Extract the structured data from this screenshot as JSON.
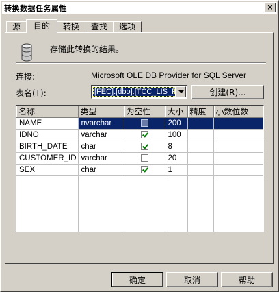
{
  "window": {
    "title": "转换数据任务属性",
    "close_label": "×"
  },
  "tabs": [
    {
      "label": "源",
      "active": false
    },
    {
      "label": "目的",
      "active": true
    },
    {
      "label": "转换",
      "active": false
    },
    {
      "label": "查找",
      "active": false
    },
    {
      "label": "选项",
      "active": false
    }
  ],
  "destination": {
    "icon": "database-icon",
    "description": "存储此转换的结果。",
    "connection_label": "连接:",
    "connection_value": "Microsoft OLE DB Provider for SQL Server",
    "table_label": "表名(T):",
    "table_value": "[FEC].[dbo].[TCC_LIS_PE",
    "create_button": "创建(R)..."
  },
  "grid": {
    "headers": [
      "名称",
      "类型",
      "为空性",
      "大小",
      "精度",
      "小数位数"
    ],
    "rows": [
      {
        "name": "NAME",
        "type": "nvarchar",
        "nullable": false,
        "size": "200",
        "precision": "",
        "scale": "",
        "selected": true
      },
      {
        "name": "IDNO",
        "type": "varchar",
        "nullable": true,
        "size": "100",
        "precision": "",
        "scale": "",
        "selected": false
      },
      {
        "name": "BIRTH_DATE",
        "type": "char",
        "nullable": true,
        "size": "8",
        "precision": "",
        "scale": "",
        "selected": false
      },
      {
        "name": "CUSTOMER_ID",
        "type": "varchar",
        "nullable": false,
        "size": "20",
        "precision": "",
        "scale": "",
        "selected": false
      },
      {
        "name": "SEX",
        "type": "char",
        "nullable": true,
        "size": "1",
        "precision": "",
        "scale": "",
        "selected": false
      }
    ]
  },
  "buttons": {
    "ok": "确定",
    "cancel": "取消",
    "help": "帮助"
  },
  "colors": {
    "selection": "#0a246a",
    "face": "#d4d0c8",
    "check": "#007a00"
  }
}
